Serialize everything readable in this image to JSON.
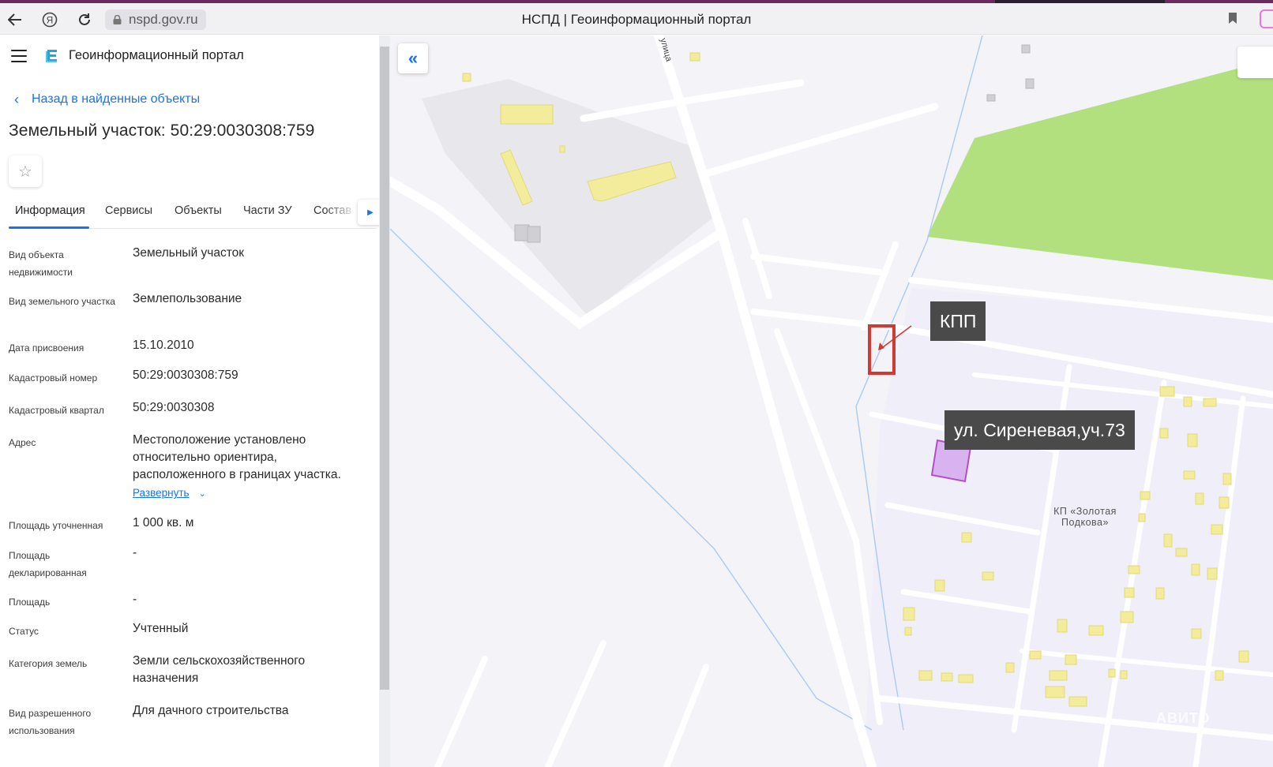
{
  "browser": {
    "url": "nspd.gov.ru",
    "page_title": "НСПД | Геоинформационный портал"
  },
  "app": {
    "title": "Геоинформационный портал"
  },
  "back_link": "Назад в найденные объекты",
  "object_title": "Земельный участок: 50:29:0030308:759",
  "tabs": [
    {
      "label": "Информация"
    },
    {
      "label": "Сервисы"
    },
    {
      "label": "Объекты"
    },
    {
      "label": "Части ЗУ"
    },
    {
      "label": "Состав"
    }
  ],
  "properties": [
    {
      "label": "Вид объекта недвижимости",
      "value": "Земельный участок"
    },
    {
      "label": "Вид земельного участка",
      "value": "Землепользование"
    },
    {
      "label": "Дата присвоения",
      "value": "15.10.2010"
    },
    {
      "label": "Кадастровый номер",
      "value": "50:29:0030308:759"
    },
    {
      "label": "Кадастровый квартал",
      "value": "50:29:0030308"
    },
    {
      "label": "Адрес",
      "value": "Местоположение установлено относительно ориентира, расположенного в границах участка."
    },
    {
      "label": "Площадь уточненная",
      "value": "1 000 кв. м"
    },
    {
      "label": "Площадь декларированная",
      "value": "-"
    },
    {
      "label": "Площадь",
      "value": "-"
    },
    {
      "label": "Статус",
      "value": "Учтенный"
    },
    {
      "label": "Категория земель",
      "value": "Земли сельскохозяйственного назначения"
    },
    {
      "label": "Вид разрешенного использования",
      "value": "Для дачного строительства"
    }
  ],
  "expand_label": "Развернуть",
  "map": {
    "street_label": "улица",
    "kpp_label": "КПП",
    "plot_label": "ул. Сиреневая,уч.73",
    "settlement_label_line1": "КП «Золотая",
    "settlement_label_line2": "Подкова»",
    "watermark": "АВИТО",
    "colors": {
      "forest": "#b2e07f",
      "building": "#f3ec9a",
      "plot_fill": "#d9b3f0",
      "plot_stroke": "#b24fc4",
      "kpp_frame": "#d03a33",
      "road": "#ffffff",
      "water_line": "#9dc3ea"
    }
  }
}
